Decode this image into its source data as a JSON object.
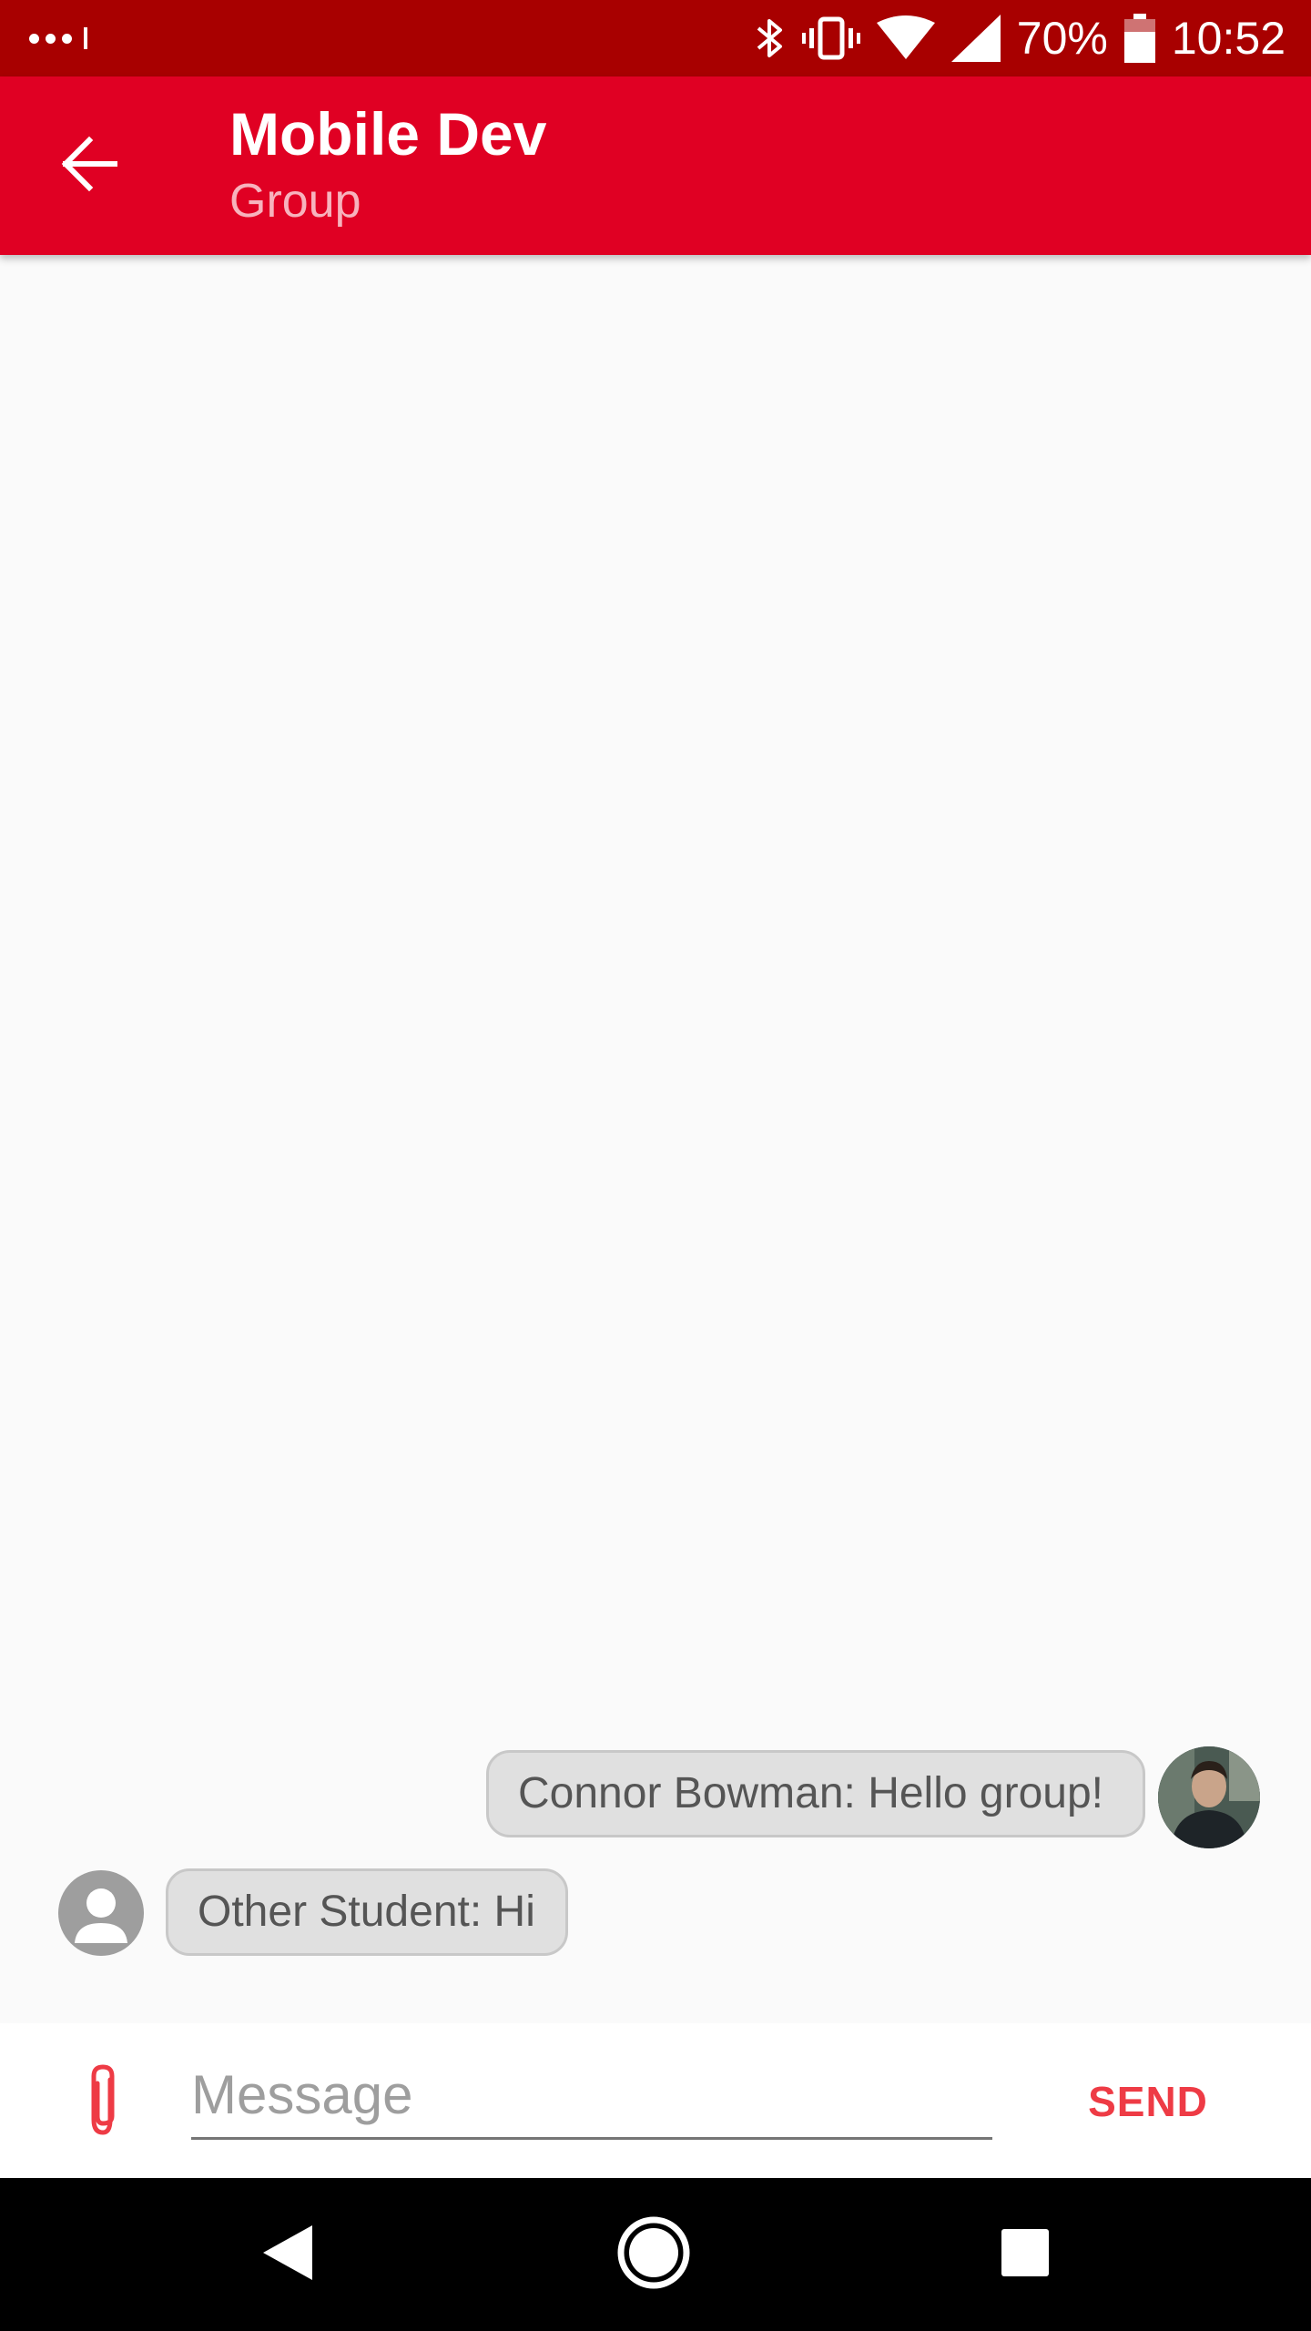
{
  "status_bar": {
    "battery": "70%",
    "time": "10:52",
    "icons": [
      "notification-dots-icon",
      "bluetooth-icon",
      "vibrate-icon",
      "wifi-icon",
      "signal-icon",
      "battery-icon"
    ]
  },
  "app_bar": {
    "title": "Mobile Dev",
    "subtitle": "Group",
    "back_icon": "arrow-back-icon"
  },
  "messages": [
    {
      "text": "Connor Bowman: Hello group!",
      "direction": "outgoing",
      "avatar": "user-photo"
    },
    {
      "text": "Other Student: Hi",
      "direction": "incoming",
      "avatar": "default-person-icon"
    }
  ],
  "composer": {
    "placeholder": "Message",
    "value": "",
    "send_label": "SEND",
    "attach_icon": "paperclip-icon"
  },
  "nav_bar": {
    "icons": [
      "nav-back-icon",
      "nav-home-icon",
      "nav-recents-icon"
    ]
  },
  "colors": {
    "status_bar": "#a80000",
    "app_bar": "#e00023",
    "accent": "#ee3b45",
    "background": "#fafafa",
    "bubble": "#e0e0e0"
  }
}
